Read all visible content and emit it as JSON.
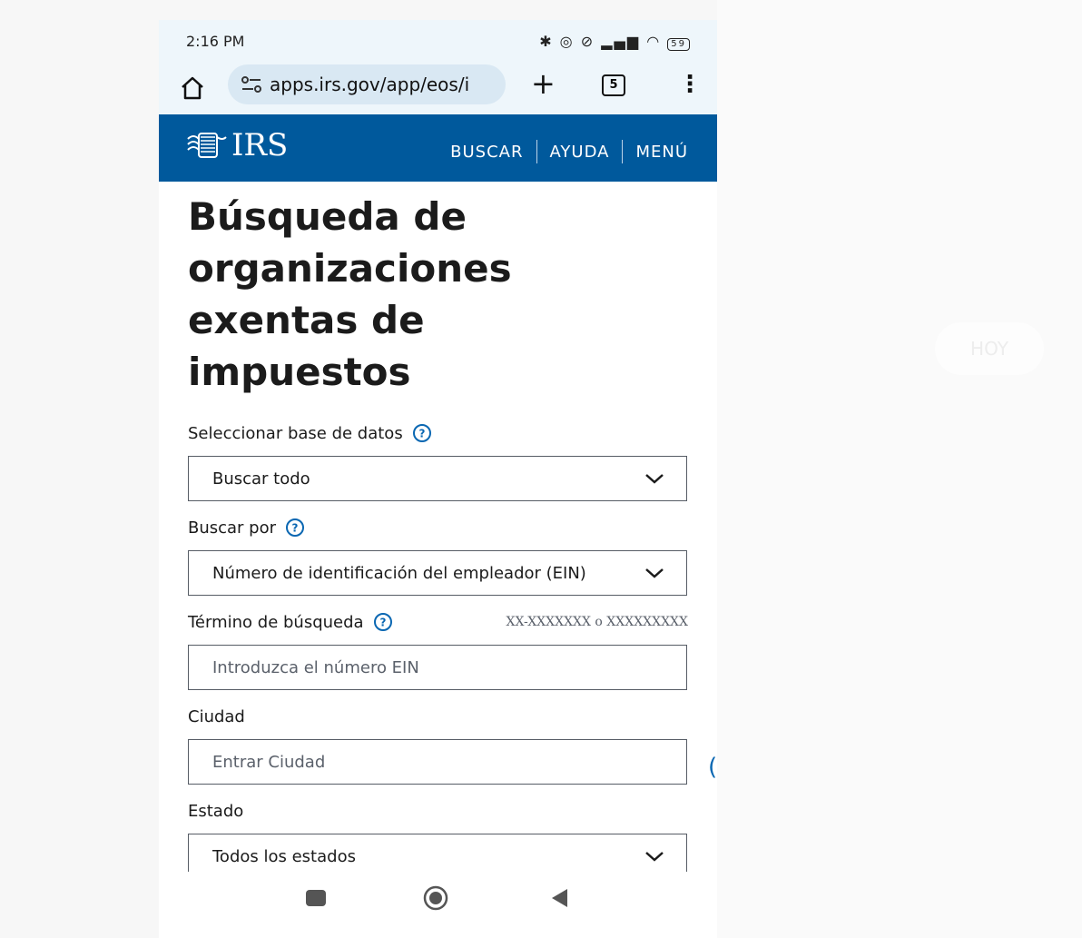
{
  "status_bar": {
    "time": "2:16 PM",
    "icons_text": "✱ ◎ ⊘ ▂▄▆ ◠ ",
    "battery": "59"
  },
  "browser": {
    "url": "apps.irs.gov/app/eos/i",
    "tab_count": "5"
  },
  "header": {
    "logo_text": "IRS",
    "nav": [
      "BUSCAR",
      "AYUDA",
      "MENÚ"
    ]
  },
  "page": {
    "title": "Búsqueda de organizaciones exentas de impuestos"
  },
  "form": {
    "database": {
      "label": "Seleccionar base de datos",
      "value": "Buscar todo"
    },
    "search_by": {
      "label": "Buscar por",
      "value": "Número de identificación del empleador (EIN)"
    },
    "search_term": {
      "label": "Término de búsqueda",
      "hint": "XX-XXXXXXX o XXXXXXXXX",
      "placeholder": "Introduzca el número EIN"
    },
    "city": {
      "label": "Ciudad",
      "placeholder": "Entrar Ciudad"
    },
    "state": {
      "label": "Estado",
      "value": "Todos los estados"
    }
  },
  "background": {
    "ghost_label": "HOY"
  },
  "colors": {
    "irs_blue": "#00599c",
    "help_blue": "#0a67b2",
    "browser_bar": "#eef6fb"
  }
}
